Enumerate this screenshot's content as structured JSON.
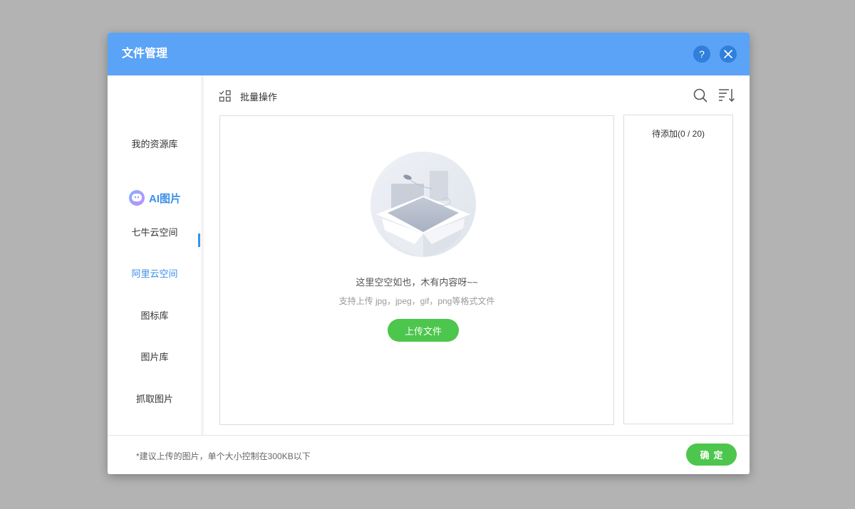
{
  "dialog": {
    "title": "文件管理",
    "help_label": "?"
  },
  "sidebar": {
    "items": [
      {
        "label": "我的资源库"
      },
      {
        "label": "AI图片"
      },
      {
        "label": "七牛云空间"
      },
      {
        "label": "阿里云空间"
      },
      {
        "label": "图标库"
      },
      {
        "label": "图片库"
      },
      {
        "label": "抓取图片"
      }
    ],
    "active_index": 3
  },
  "toolbar": {
    "batch_label": "批量操作",
    "icons": [
      "batch-select-icon",
      "search-icon",
      "sort-icon"
    ]
  },
  "content": {
    "empty_title": "这里空空如也，木有内容呀~~",
    "empty_hint": "支持上传 jpg，jpeg，gif，png等格式文件",
    "upload_label": "上传文件"
  },
  "pending": {
    "title": "待添加(0 / 20)"
  },
  "footer": {
    "note": "*建议上传的图片，单个大小控制在300KB以下",
    "confirm_label": "确定"
  },
  "colors": {
    "header": "#5aa3f6",
    "accent": "#3b8fe8",
    "button_green": "#4cc64c"
  }
}
